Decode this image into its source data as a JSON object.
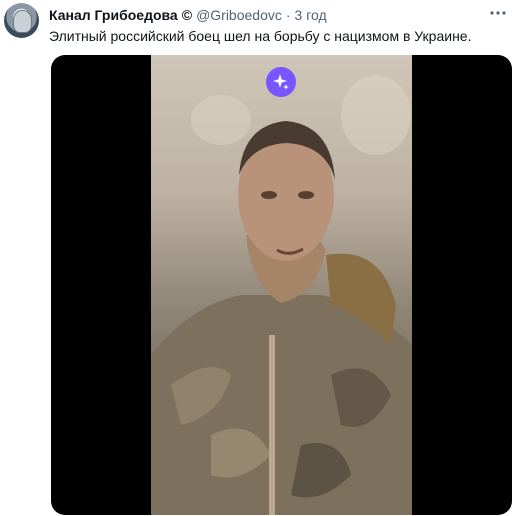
{
  "tweet": {
    "author": "Канал Грибоедова",
    "copyright_mark": "©",
    "handle": "@Griboedovc",
    "separator": "·",
    "time": "3 год",
    "text": "Элитный российский боец шел на борьбу с нацизмом в Украине."
  },
  "icons": {
    "more": "more-dots-icon",
    "media_badge": "sparkle-icon"
  },
  "colors": {
    "badge": "#7856ff",
    "secondary_text": "#536471",
    "media_background": "#000000"
  }
}
